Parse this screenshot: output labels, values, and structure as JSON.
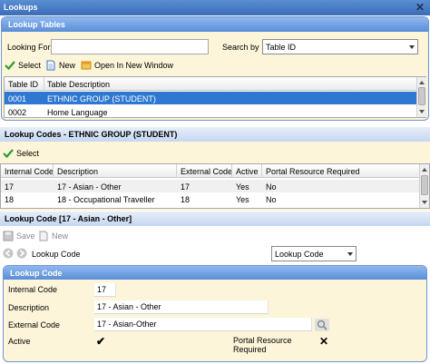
{
  "window": {
    "title": "Lookups"
  },
  "lookup_tables": {
    "header": "Lookup Tables",
    "looking_for_label": "Looking For",
    "looking_for_value": "",
    "search_by_label": "Search by",
    "search_by_value": "Table ID",
    "toolbar": {
      "select": "Select",
      "new": "New",
      "open_new_window": "Open In New Window"
    },
    "columns": [
      "Table ID",
      "Table Description"
    ],
    "rows": [
      {
        "id": "0001",
        "description": "ETHNIC GROUP (STUDENT)",
        "selected": true
      },
      {
        "id": "0002",
        "description": "Home Language",
        "selected": false
      }
    ]
  },
  "lookup_codes": {
    "header": "Lookup Codes - ETHNIC GROUP (STUDENT)",
    "toolbar": {
      "select": "Select"
    },
    "columns": [
      "Internal Code",
      "Description",
      "External Code",
      "Active",
      "Portal Resource Required"
    ],
    "rows": [
      {
        "internal": "17",
        "description": "17 - Asian - Other",
        "external": "17",
        "active": "Yes",
        "portal": "No"
      },
      {
        "internal": "18",
        "description": "18 - Occupational Traveller",
        "external": "18",
        "active": "Yes",
        "portal": "No"
      }
    ]
  },
  "lookup_code": {
    "header": "Lookup Code [17 - Asian - Other]",
    "toolbar": {
      "save": "Save",
      "new": "New"
    },
    "nav_label": "Lookup Code",
    "view_select": "Lookup Code",
    "panel_header": "Lookup Code",
    "fields": {
      "internal_code_label": "Internal Code",
      "internal_code_value": "17",
      "description_label": "Description",
      "description_value": "17 - Asian - Other",
      "external_code_label": "External Code",
      "external_code_value": "17 - Asian-Other",
      "active_label": "Active",
      "active_value": "✔",
      "portal_label": "Portal Resource Required",
      "portal_value": "✕"
    }
  },
  "colors": {
    "accent": "#2f78d2",
    "header_blue": "#5a8ed8",
    "cream": "#fcf5d9",
    "select_green": "#2e9b2e"
  }
}
